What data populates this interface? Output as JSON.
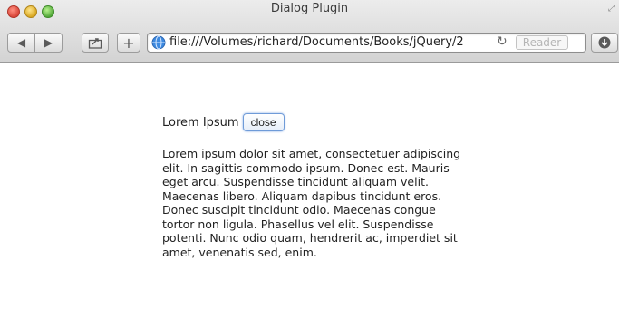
{
  "window": {
    "title": "Dialog Plugin"
  },
  "toolbar": {
    "back_icon": "◀",
    "forward_icon": "▶",
    "add_label": "+",
    "url": "file:///Volumes/richard/Documents/Books/jQuery/2",
    "reader_label": "Reader"
  },
  "dialog": {
    "title": "Lorem Ipsum",
    "close_label": "close",
    "body": "Lorem ipsum dolor sit amet, consectetuer adipiscing elit. In sagittis commodo ipsum. Donec est. Mauris eget arcu. Suspendisse tincidunt aliquam velit. Maecenas libero. Aliquam dapibus tincidunt eros. Donec suscipit tincidunt odio. Maecenas congue tortor non ligula. Phasellus vel elit. Suspendisse potenti. Nunc odio quam, hendrerit ac, imperdiet sit amet, venenatis sed, enim."
  },
  "icons": {
    "close": "close-icon",
    "minimize": "minimize-icon",
    "zoom": "zoom-icon",
    "share": "share-icon",
    "globe": "globe-icon",
    "reload": "reload-icon",
    "download": "download-icon",
    "resize": "resize-icon"
  }
}
